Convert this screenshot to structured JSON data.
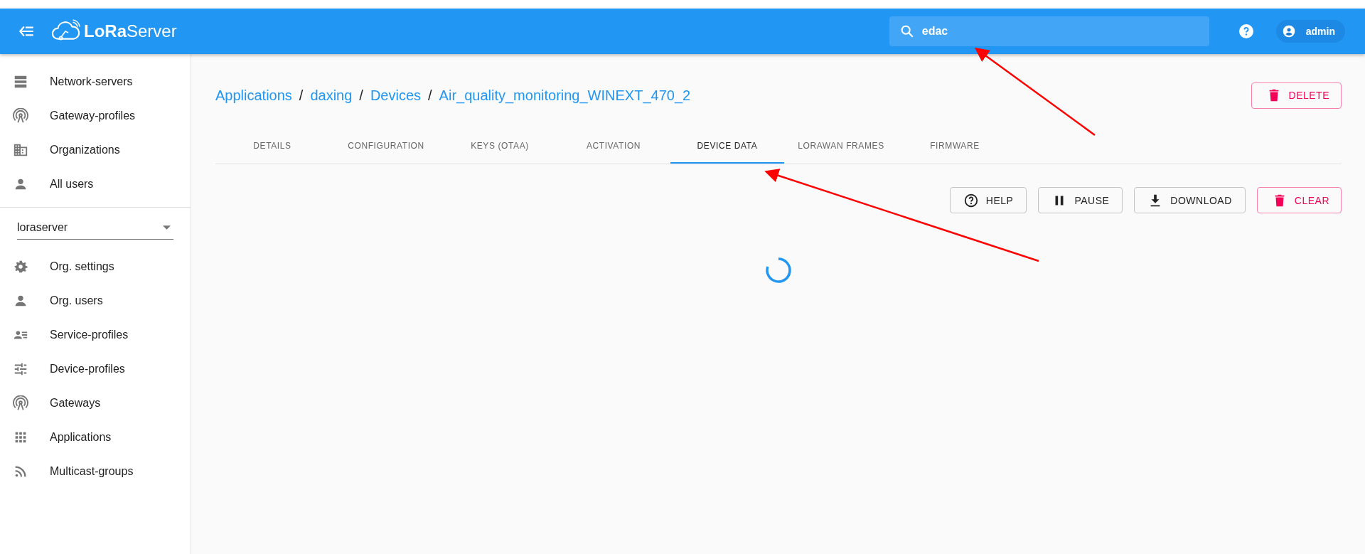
{
  "appbar": {
    "brand": {
      "lo": "LoRa",
      "rest": "Server"
    },
    "search": {
      "value": "edac"
    },
    "user": "admin"
  },
  "sidebar": {
    "top_items": [
      {
        "label": "Network-servers"
      },
      {
        "label": "Gateway-profiles"
      },
      {
        "label": "Organizations"
      },
      {
        "label": "All users"
      }
    ],
    "organization_select": {
      "value": "loraserver"
    },
    "org_items": [
      {
        "label": "Org. settings"
      },
      {
        "label": "Org. users"
      },
      {
        "label": "Service-profiles"
      },
      {
        "label": "Device-profiles"
      },
      {
        "label": "Gateways"
      },
      {
        "label": "Applications"
      },
      {
        "label": "Multicast-groups"
      }
    ]
  },
  "breadcrumb": [
    {
      "kind": "link",
      "text": "Applications"
    },
    {
      "kind": "separator",
      "text": "/"
    },
    {
      "kind": "link",
      "text": "daxing"
    },
    {
      "kind": "separator",
      "text": "/"
    },
    {
      "kind": "link",
      "text": "Devices"
    },
    {
      "kind": "separator",
      "text": "/"
    },
    {
      "kind": "link",
      "text": "Air_quality_monitoring_WINEXT_470_2"
    }
  ],
  "delete_button": "DELETE",
  "tabs": [
    {
      "label": "DETAILS",
      "selected": false
    },
    {
      "label": "CONFIGURATION",
      "selected": false
    },
    {
      "label": "KEYS (OTAA)",
      "selected": false
    },
    {
      "label": "ACTIVATION",
      "selected": false
    },
    {
      "label": "DEVICE DATA",
      "selected": true
    },
    {
      "label": "LORAWAN FRAMES",
      "selected": false
    },
    {
      "label": "FIRMWARE",
      "selected": false
    }
  ],
  "actions": [
    {
      "label": "HELP",
      "kind": "help"
    },
    {
      "label": "PAUSE",
      "kind": "pause"
    },
    {
      "label": "DOWNLOAD",
      "kind": "download"
    },
    {
      "label": "CLEAR",
      "kind": "clear"
    }
  ]
}
